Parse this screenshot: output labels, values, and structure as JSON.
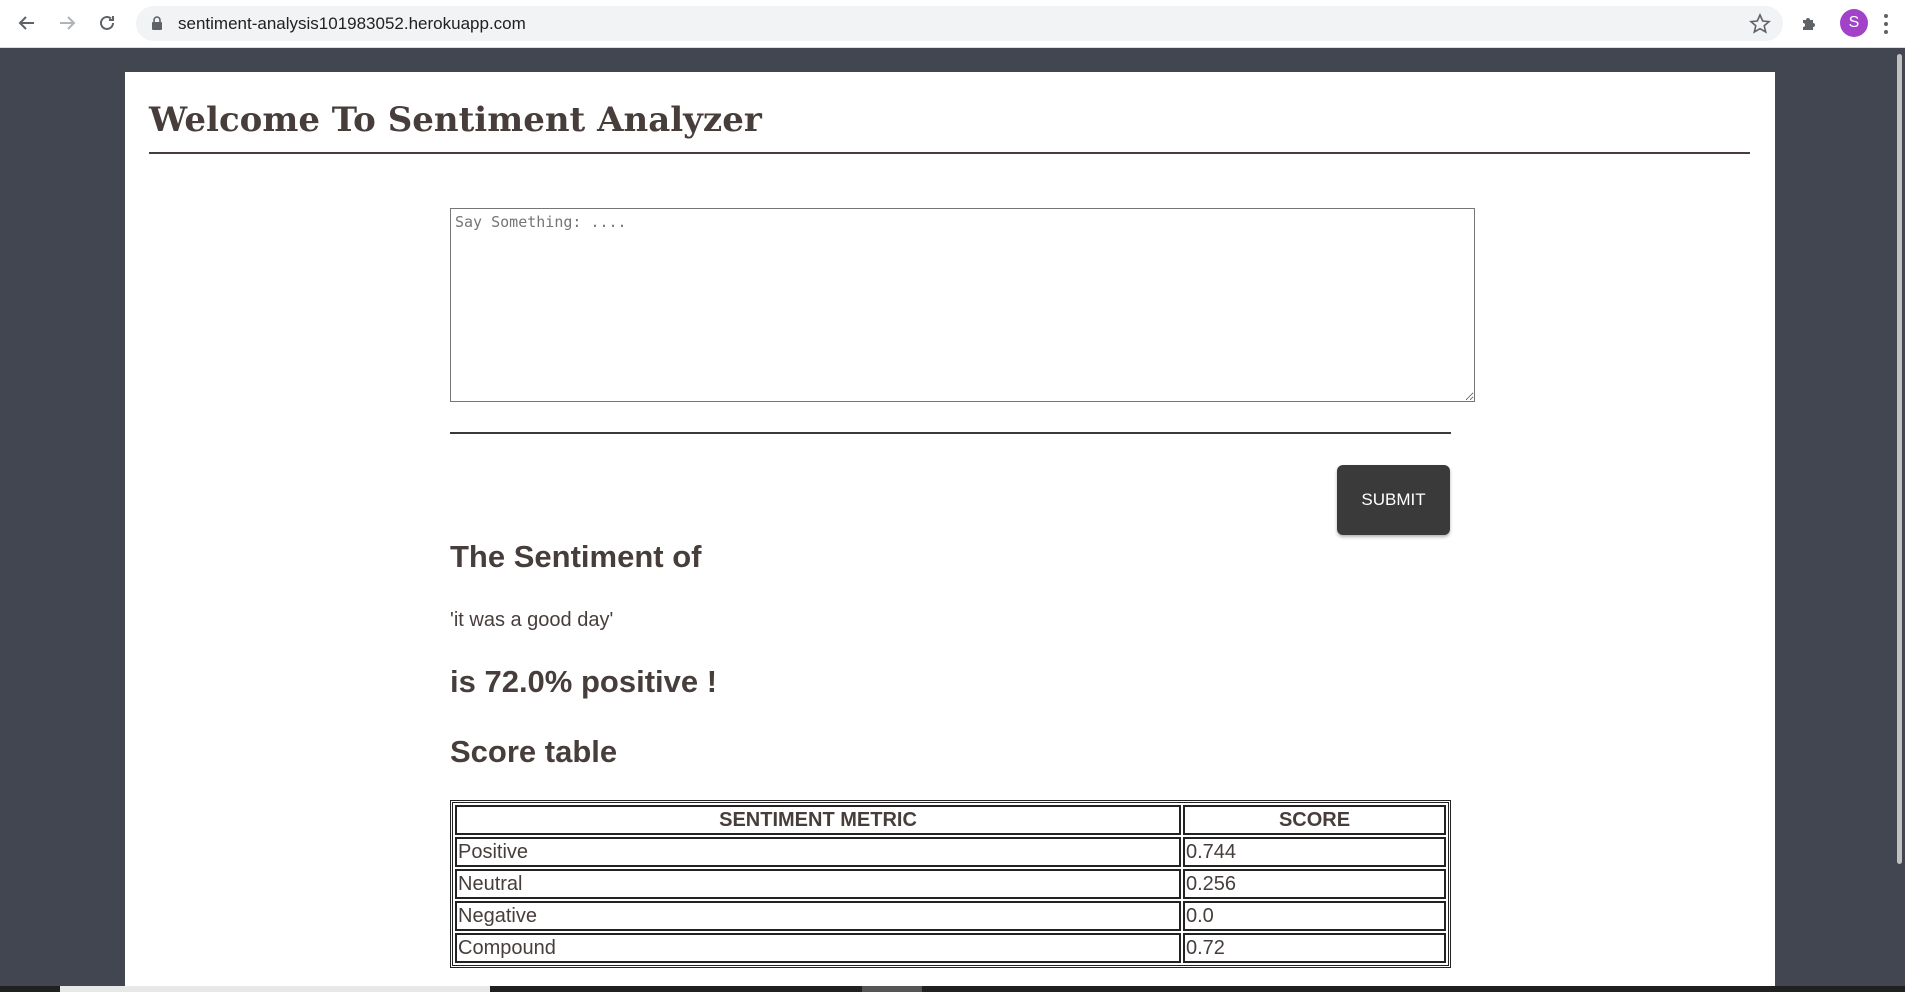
{
  "browser": {
    "url": "sentiment-analysis101983052.herokuapp.com",
    "profile_initial": "S",
    "icons": [
      "back-arrow-icon",
      "forward-arrow-icon",
      "reload-icon",
      "lock-icon",
      "star-icon",
      "extensions-icon",
      "menu-dots-icon"
    ]
  },
  "page": {
    "title": "Welcome To Sentiment Analyzer",
    "input_placeholder": "Say Something: ....",
    "submit_label": "SUBMIT",
    "sentiment_heading": "The Sentiment of",
    "analyzed_text": "'it was a good day'",
    "result_text": "is 72.0% positive !",
    "score_heading": "Score table"
  },
  "score_table": {
    "headers": [
      "SENTIMENT METRIC",
      "SCORE"
    ],
    "rows": [
      [
        "Positive",
        "0.744"
      ],
      [
        "Neutral",
        "0.256"
      ],
      [
        "Negative",
        "0.0"
      ],
      [
        "Compound",
        "0.72"
      ]
    ]
  },
  "colors": {
    "background": "#414650",
    "text": "#473e3c",
    "button": "#3a3a3a",
    "avatar": "#a142c9"
  }
}
